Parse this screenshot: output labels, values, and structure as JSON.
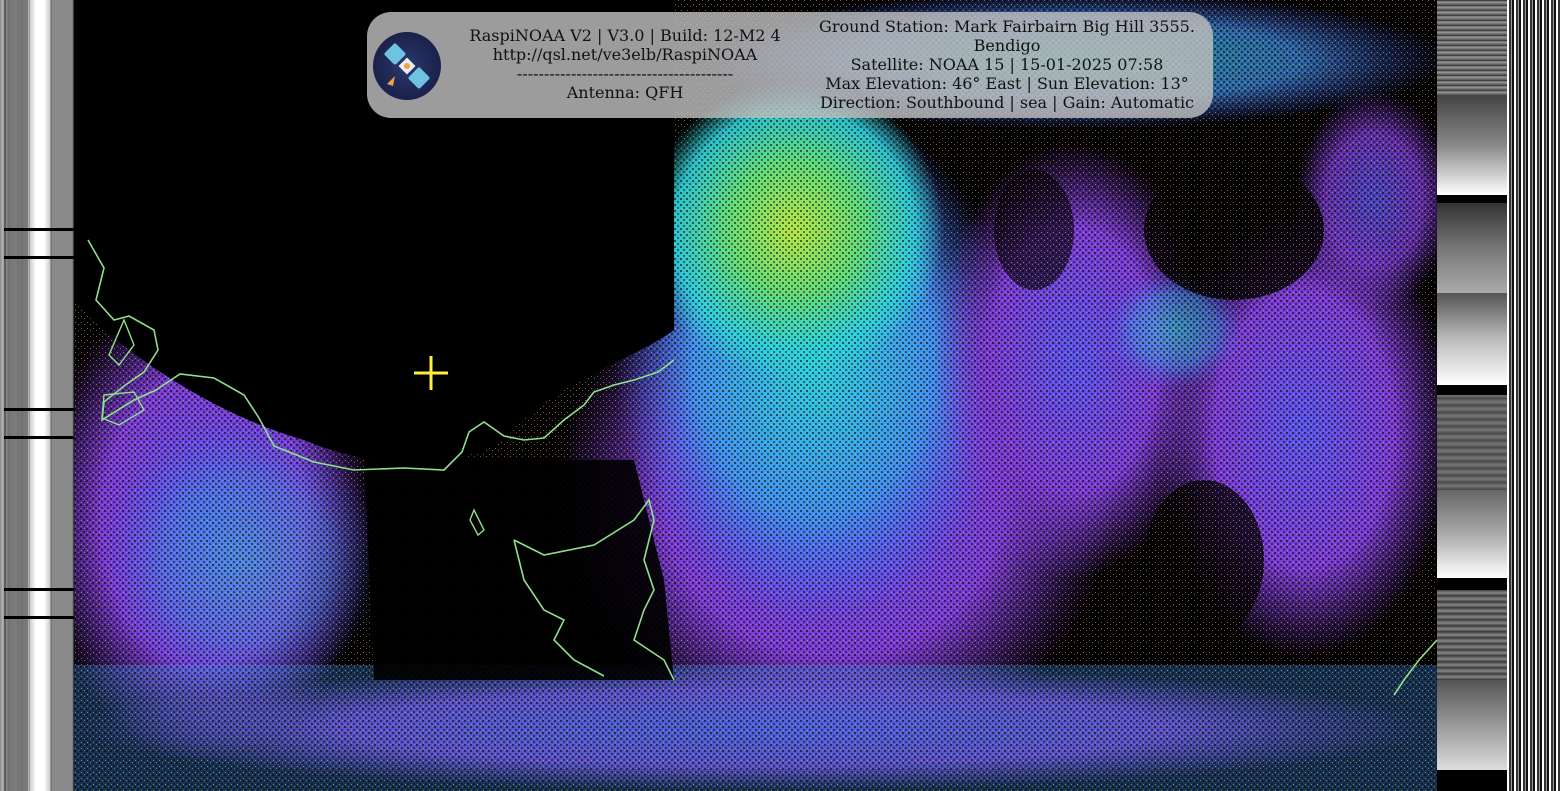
{
  "overlay": {
    "left_lines": [
      "RaspiNOAA V2 | V3.0 | Build: 12-M2 4",
      "http://qsl.net/ve3elb/RaspiNOAA",
      "----------------------------------------",
      "Antenna: QFH"
    ],
    "right_lines": [
      "Ground Station: Mark Fairbairn Big Hill 3555.",
      "Bendigo",
      "Satellite: NOAA 15 | 15-01-2025 07:58",
      "Max Elevation: 46° East | Sun Elevation: 13°",
      "Direction: Southbound | sea | Gain: Automatic"
    ]
  },
  "colors": {
    "coastline": "#8fe08a",
    "crosshair": "#ffef3a",
    "cloud_purple": "#7a3bd6",
    "cloud_blue": "#4a5cff",
    "cloud_cyan": "#2ad3e0",
    "cloud_green": "#b4e84a"
  },
  "icons": {
    "logo": "satellite-icon",
    "marker": "crosshair-icon"
  }
}
